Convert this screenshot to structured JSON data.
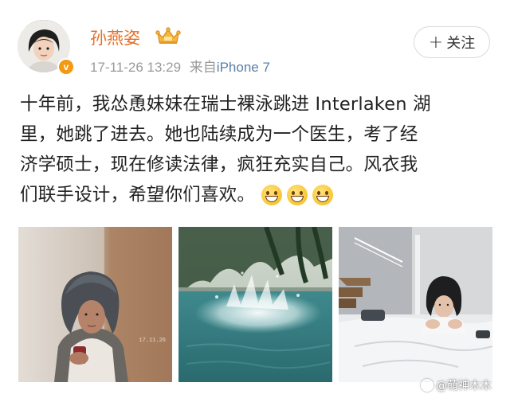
{
  "post": {
    "username": "孙燕姿",
    "timestamp": "17-11-26 13:29",
    "source_prefix": "来自",
    "device": "iPhone 7",
    "follow_label": "关注",
    "follow_plus": "+",
    "verified_badge": "v",
    "text_lines": [
      "十年前，我怂恿妹妹在瑞士裸泳跳进 Interlaken 湖",
      "里，她跳了进去。她也陆续成为一个医生，考了经",
      "济学硕士，现在修读法律，疯狂充实自己。风衣我",
      "们联手设计，希望你们喜欢。"
    ],
    "emoji_count": 3,
    "emoji_icon": "grinning-face-icon"
  },
  "photos": [
    {
      "name": "woman-with-towel-photo",
      "stamp": "17.11.26"
    },
    {
      "name": "pool-splash-photo"
    },
    {
      "name": "woman-on-bed-photo"
    }
  ],
  "watermark": {
    "text": "@萌神木木",
    "icon": "weibo-icon"
  },
  "colors": {
    "username": "#e36f29",
    "meta": "#9a9a9a",
    "device": "#5b7fa8",
    "verified": "#f29a12",
    "body_text": "#222222"
  }
}
